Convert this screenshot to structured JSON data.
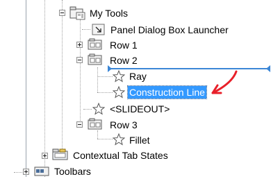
{
  "tree": {
    "my_tools": "My Tools",
    "panel_dialog_box_launcher": "Panel Dialog Box Launcher",
    "row1": "Row 1",
    "row2": "Row 2",
    "ray": "Ray",
    "construction_line": "Construction Line",
    "slideout": "<SLIDEOUT>",
    "row3": "Row 3",
    "fillet": "Fillet",
    "contextual_tab_states": "Contextual Tab States",
    "toolbars": "Toolbars"
  },
  "colors": {
    "selection": "#3399ff",
    "insert_indicator": "#3b86d6",
    "annotation_arrow": "#e8202a"
  }
}
